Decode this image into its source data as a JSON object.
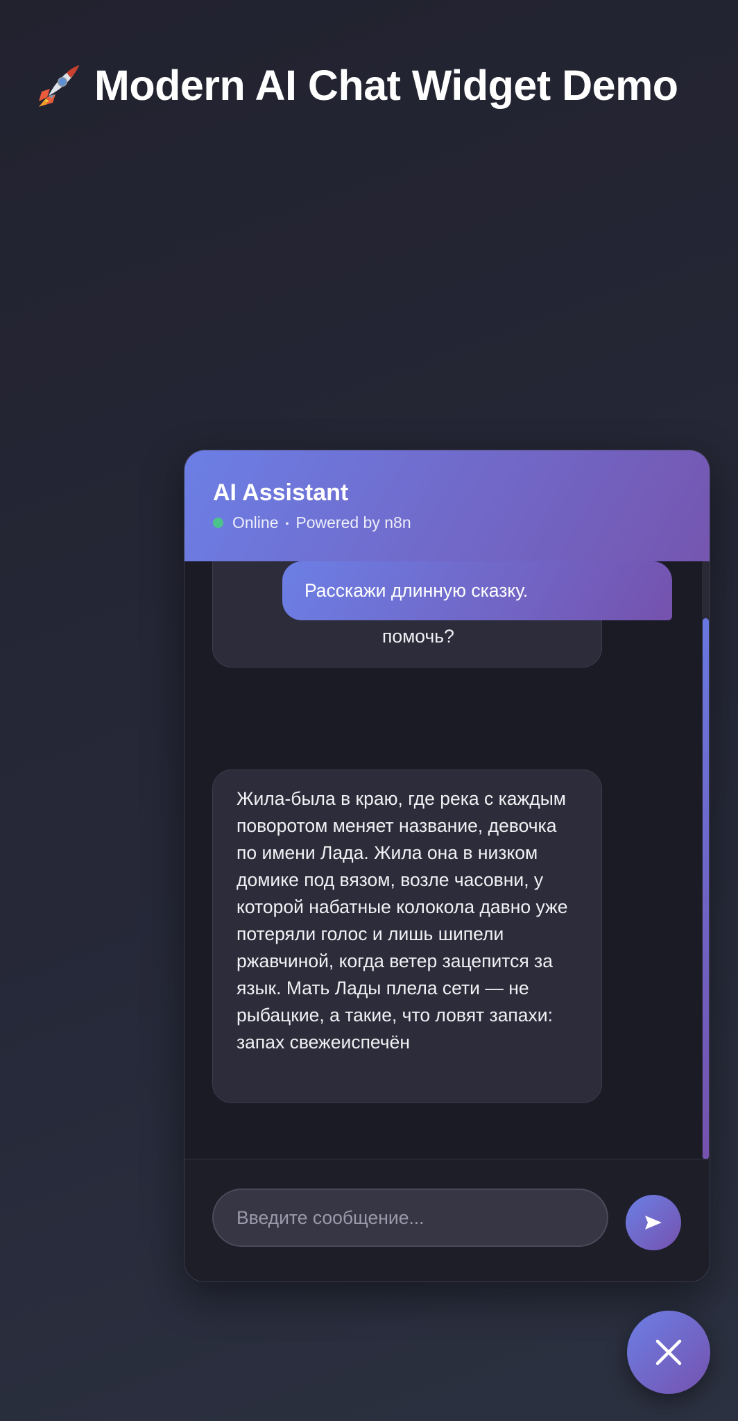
{
  "page": {
    "title": "Modern AI Chat Widget Demo",
    "title_icon": "rocket-icon"
  },
  "widget": {
    "header": {
      "name": "AI Assistant",
      "status": "Online",
      "separator": "•",
      "powered_by": "Powered by n8n"
    },
    "messages": [
      {
        "role": "bot",
        "text": "👋 Привет! Я ваш AI ассистент. Чем могу помочь?"
      },
      {
        "role": "user",
        "text": "Расскажи длинную сказку."
      },
      {
        "role": "bot",
        "text": "Жила-была в краю, где река с каждым поворотом меняет название, девочка по имени Лада. Жила она в низком домике под вязом, возле часовни, у которой набатные колокола давно уже потеряли голос и лишь шипели ржавчиной, когда ветер зацепится за язык. Мать Лады плела сети — не рыбацкие, а такие, что ловят запахи: запах свежеиспечён"
      }
    ],
    "composer": {
      "placeholder": "Введите сообщение...",
      "value": "",
      "send_icon": "send-arrow-icon"
    }
  },
  "launcher": {
    "icon": "close-icon"
  },
  "colors": {
    "accent_start": "#6c7fe5",
    "accent_end": "#7552ae",
    "online": "#4cc38a",
    "bot_bubble": "#2c2c3a",
    "panel": "#1b1b26"
  }
}
